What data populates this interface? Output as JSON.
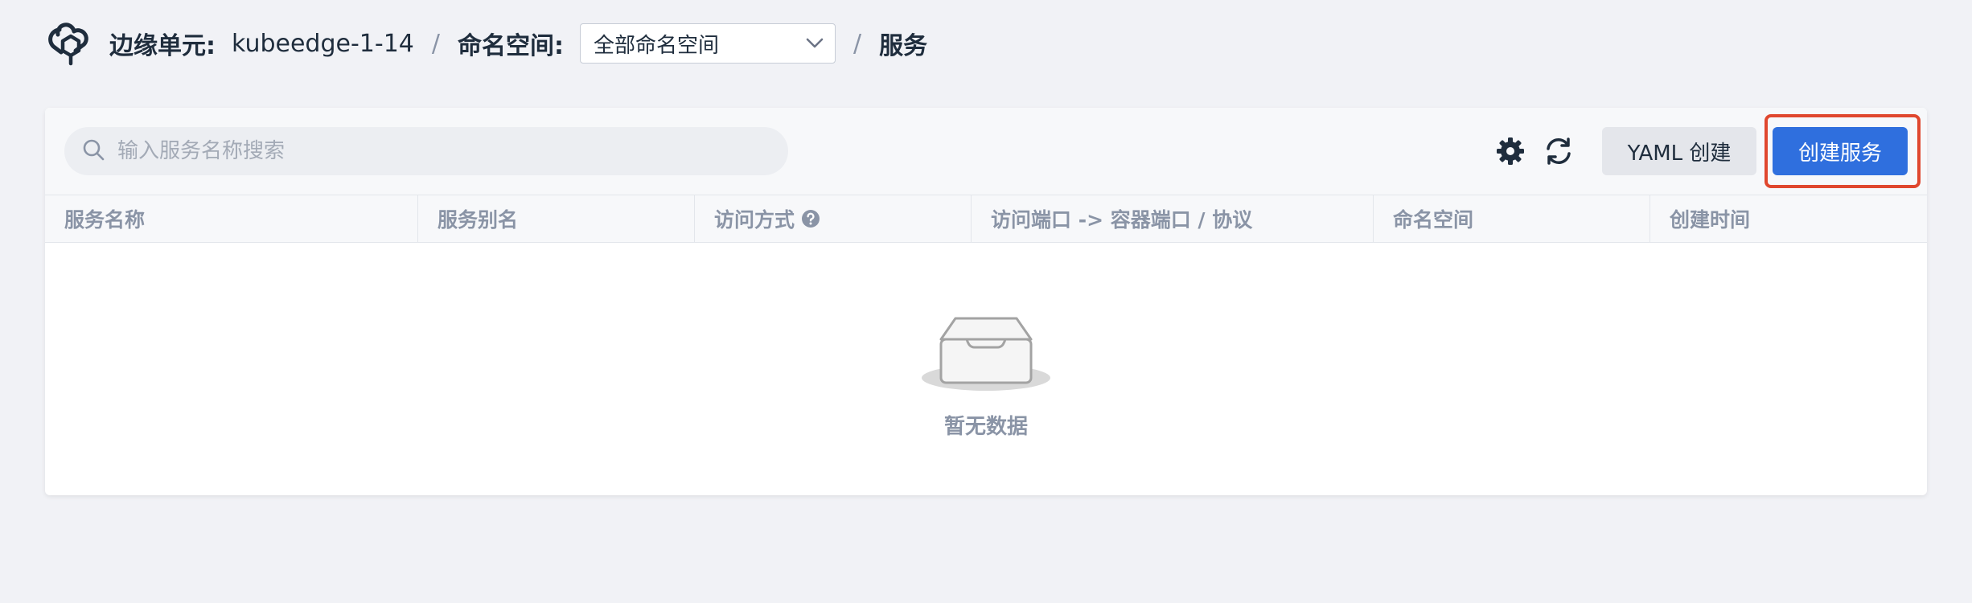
{
  "header": {
    "logo_icon": "kubeedge-logo-icon",
    "edge_unit_label": "边缘单元:",
    "edge_unit_value": "kubeedge-1-14",
    "separator": "/",
    "namespace_label": "命名空间:",
    "namespace_selected": "全部命名空间",
    "current_page": "服务"
  },
  "toolbar": {
    "search_placeholder": "输入服务名称搜索",
    "search_value": "",
    "settings_icon": "gear-icon",
    "refresh_icon": "refresh-icon",
    "yaml_create_label": "YAML 创建",
    "create_service_label": "创建服务"
  },
  "table": {
    "columns": [
      "服务名称",
      "服务别名",
      "访问方式",
      "访问端口 -> 容器端口 / 协议",
      "命名空间",
      "创建时间"
    ],
    "rows": []
  },
  "empty_state": {
    "icon": "empty-inbox-icon",
    "text": "暂无数据"
  },
  "colors": {
    "page_background": "#f1f2f6",
    "primary": "#2f6fde",
    "highlight_border": "#e0472e",
    "header_text": "#8a94a6"
  }
}
